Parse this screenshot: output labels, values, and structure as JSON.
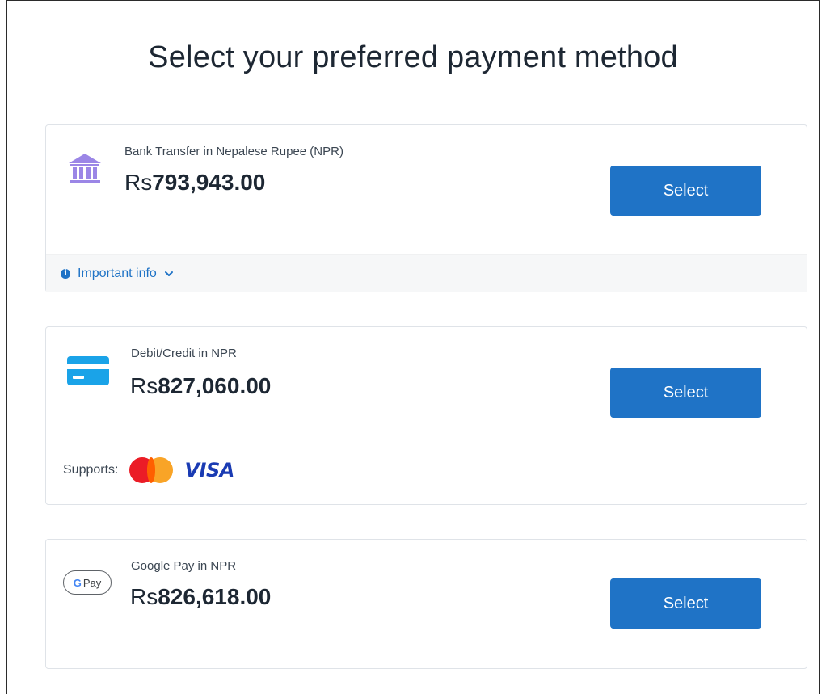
{
  "page": {
    "title": "Select your preferred payment method"
  },
  "methods": {
    "bank": {
      "label": "Bank Transfer in Nepalese Rupee (NPR)",
      "currency_symbol": "Rs",
      "amount": "793,943.00",
      "icon": "bank-icon",
      "select_label": "Select",
      "info_label": "Important info"
    },
    "card": {
      "label": "Debit/Credit in NPR",
      "currency_symbol": "Rs",
      "amount": "827,060.00",
      "icon": "credit-card-icon",
      "select_label": "Select",
      "supports_label": "Supports:",
      "visa_text": "VISA"
    },
    "gpay": {
      "label": "Google Pay in NPR",
      "currency_symbol": "Rs",
      "amount": "826,618.00",
      "icon": "google-pay-icon",
      "badge_g": "G",
      "badge_pay": "Pay",
      "select_label": "Select"
    }
  },
  "colors": {
    "accent": "#1f73c6",
    "bank_icon": "#9b86e6",
    "card_icon": "#1aa3e8"
  }
}
